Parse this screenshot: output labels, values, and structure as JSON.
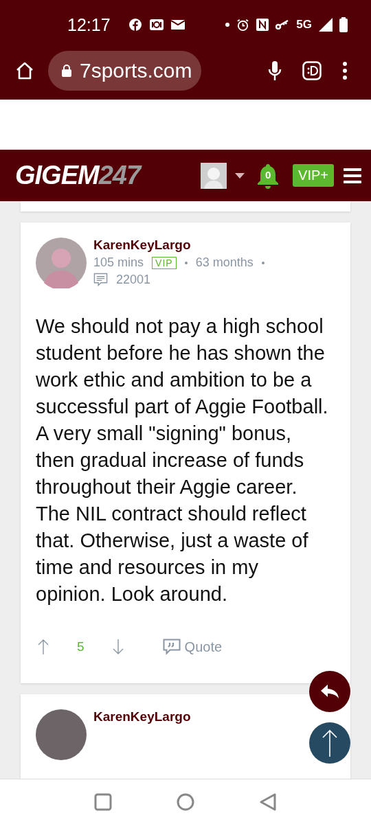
{
  "status_bar": {
    "time": "12:17",
    "network": "5G"
  },
  "browser": {
    "url": "7sports.com"
  },
  "site_header": {
    "logo_main": "GIGEM",
    "logo_number": "247",
    "notifications": "0",
    "vip_button": "VIP+"
  },
  "post": {
    "author": "KarenKeyLargo",
    "time": "105 mins",
    "badge": "VIP",
    "tenure": "63 months",
    "post_count": "22001",
    "body": "We should not pay a high school student before he has shown the work ethic and ambition to be a successful part of Aggie Football. A very small \"signing\" bonus, then gradual increase of funds throughout their Aggie career. The NIL contract should reflect that. Otherwise, just a waste of time and resources in my opinion. Look around.",
    "votes": "5",
    "quote_label": "Quote"
  },
  "next_post": {
    "author": "KarenKeyLargo"
  }
}
